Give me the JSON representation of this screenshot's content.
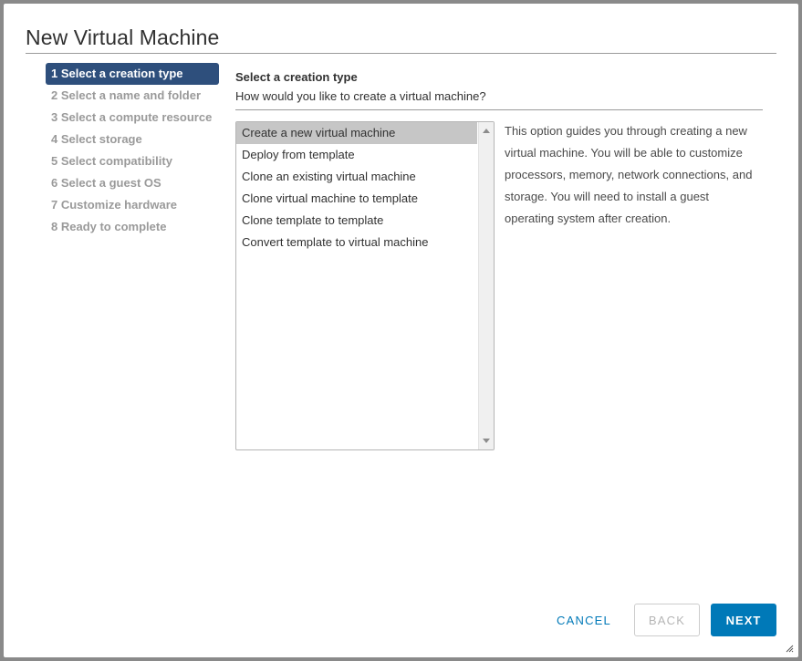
{
  "dialog": {
    "title": "New Virtual Machine"
  },
  "steps": [
    {
      "label": "1 Select a creation type",
      "active": true
    },
    {
      "label": "2 Select a name and folder",
      "active": false
    },
    {
      "label": "3 Select a compute resource",
      "active": false
    },
    {
      "label": "4 Select storage",
      "active": false
    },
    {
      "label": "5 Select compatibility",
      "active": false
    },
    {
      "label": "6 Select a guest OS",
      "active": false
    },
    {
      "label": "7 Customize hardware",
      "active": false
    },
    {
      "label": "8 Ready to complete",
      "active": false
    }
  ],
  "content": {
    "heading": "Select a creation type",
    "subheading": "How would you like to create a virtual machine?"
  },
  "creation_types": {
    "selected_index": 0,
    "options": [
      "Create a new virtual machine",
      "Deploy from template",
      "Clone an existing virtual machine",
      "Clone virtual machine to template",
      "Clone template to template",
      "Convert template to virtual machine"
    ]
  },
  "description": "This option guides you through creating a new virtual machine. You will be able to customize processors, memory, network connections, and storage. You will need to install a guest operating system after creation.",
  "footer": {
    "cancel_label": "CANCEL",
    "back_label": "BACK",
    "next_label": "NEXT"
  },
  "colors": {
    "accent": "#0079b8",
    "active_step": "#2e4f7c",
    "selected_option": "#c6c6c6"
  },
  "icons": {
    "scroll_up": "triangle-up-icon",
    "scroll_down": "triangle-down-icon",
    "resize": "resize-grip-icon"
  }
}
